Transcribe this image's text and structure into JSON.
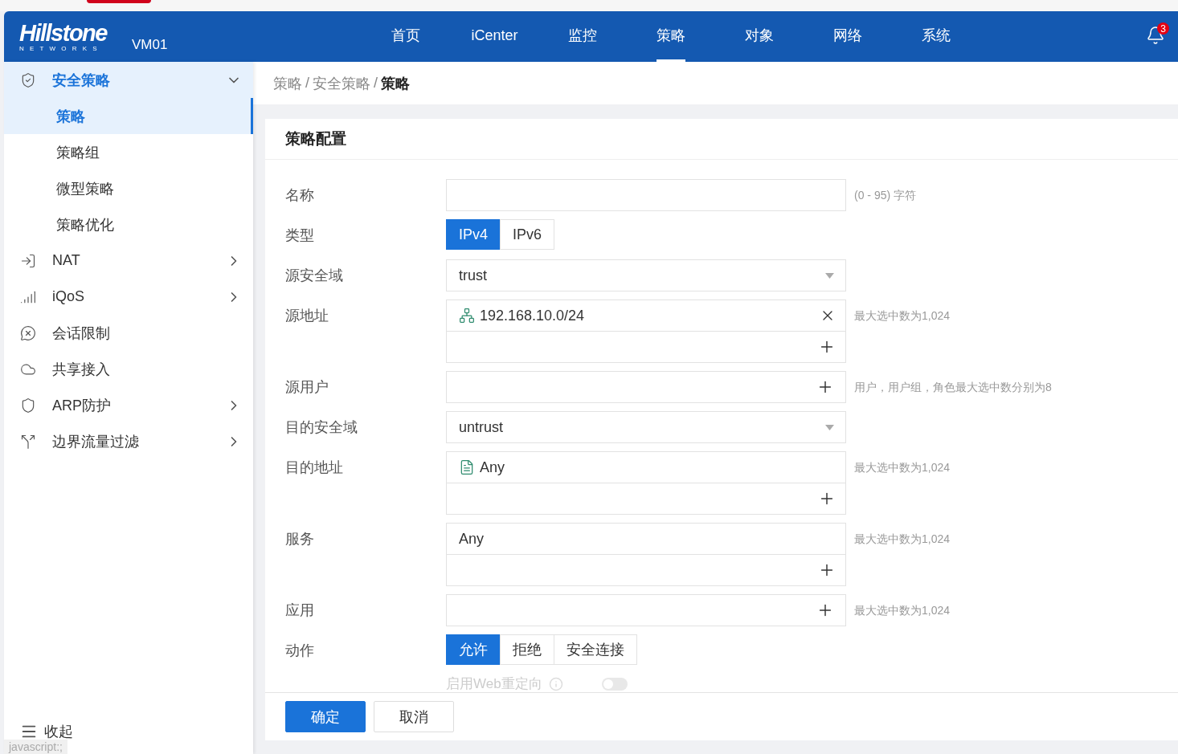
{
  "header": {
    "logo": "Hillstone",
    "logo_tagline": "NETWORKS",
    "device": "VM01",
    "nav": [
      {
        "label": "首页",
        "selected": false
      },
      {
        "label": "iCenter",
        "selected": false
      },
      {
        "label": "监控",
        "selected": false
      },
      {
        "label": "策略",
        "selected": true
      },
      {
        "label": "对象",
        "selected": false
      },
      {
        "label": "网络",
        "selected": false
      },
      {
        "label": "系统",
        "selected": false
      }
    ],
    "notifications": "3"
  },
  "sidebar": {
    "items": [
      {
        "label": "安全策略",
        "expanded": true,
        "children": [
          {
            "label": "策略",
            "selected": true
          },
          {
            "label": "策略组",
            "selected": false
          },
          {
            "label": "微型策略",
            "selected": false
          },
          {
            "label": "策略优化",
            "selected": false
          }
        ]
      },
      {
        "label": "NAT",
        "expanded": false,
        "has_children": true
      },
      {
        "label": "iQoS",
        "expanded": false,
        "has_children": true
      },
      {
        "label": "会话限制",
        "expanded": false,
        "has_children": false
      },
      {
        "label": "共享接入",
        "expanded": false,
        "has_children": false
      },
      {
        "label": "ARP防护",
        "expanded": false,
        "has_children": true
      },
      {
        "label": "边界流量过滤",
        "expanded": false,
        "has_children": true
      }
    ],
    "collapse": "收起"
  },
  "breadcrumb": {
    "separator": "/",
    "items": [
      "策略",
      "安全策略",
      "策略"
    ]
  },
  "form": {
    "title": "策略配置",
    "rows": [
      {
        "kind": "input",
        "label": "名称",
        "hint": "(0 - 95) 字符"
      },
      {
        "kind": "segmented",
        "label": "类型",
        "options": [
          {
            "label": "IPv4",
            "selected": true
          },
          {
            "label": "IPv6",
            "selected": false
          }
        ]
      },
      {
        "kind": "select",
        "label": "源安全域",
        "value": "trust"
      },
      {
        "kind": "multi",
        "label": "源地址",
        "entries": [
          {
            "text": "192.168.10.0/24",
            "removable": true
          }
        ],
        "hint": "最大选中数为1,024"
      },
      {
        "kind": "add",
        "label": "源用户",
        "hint": "用户，用户组，角色最大选中数分别为8"
      },
      {
        "kind": "select",
        "label": "目的安全域",
        "value": "untrust"
      },
      {
        "kind": "multi",
        "label": "目的地址",
        "entries": [
          {
            "text": "Any",
            "removable": false
          }
        ],
        "hint": "最大选中数为1,024"
      },
      {
        "kind": "multi",
        "label": "服务",
        "entries": [
          {
            "text": "Any",
            "removable": false
          }
        ],
        "hint": "最大选中数为1,024"
      },
      {
        "kind": "add",
        "label": "应用",
        "hint": "最大选中数为1,024"
      },
      {
        "kind": "segmented",
        "label": "动作",
        "options": [
          {
            "label": "允许",
            "selected": true
          },
          {
            "label": "拒绝",
            "selected": false
          },
          {
            "label": "安全连接",
            "selected": false
          }
        ]
      },
      {
        "kind": "toggle",
        "label": "启用Web重定向",
        "on": false,
        "disabled": true
      }
    ]
  },
  "buttons": [
    {
      "label": "确定",
      "kind": "primary"
    },
    {
      "label": "取消",
      "kind": "default"
    }
  ],
  "status_bar": {
    "text": "javascript:;"
  }
}
